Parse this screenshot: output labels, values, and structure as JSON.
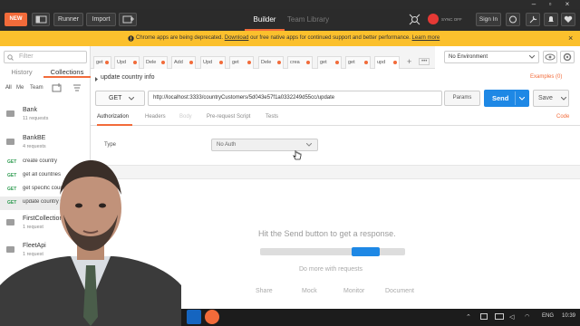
{
  "header": {
    "new_label": "NEW",
    "runner_label": "Runner",
    "import_label": "Import",
    "tab_builder": "Builder",
    "tab_team_library": "Team Library",
    "sync_status": "SYNC OFF",
    "sign_in_label": "Sign In",
    "accent_color": "#f26b3a"
  },
  "warning": {
    "prefix": "Chrome apps are being deprecated.",
    "link_download": "Download",
    "middle": "our free native apps for continued support and better performance.",
    "link_learn": "Learn more"
  },
  "sidebar": {
    "filter_placeholder": "Filter",
    "tab_history": "History",
    "tab_collections": "Collections",
    "sub_all": "All",
    "sub_me": "Me",
    "sub_team": "Team",
    "collections": [
      {
        "name": "Bank",
        "count": "11 requests"
      },
      {
        "name": "BankBE",
        "count": "4 requests"
      }
    ],
    "requests": [
      {
        "method": "GET",
        "name": "create country"
      },
      {
        "method": "GET",
        "name": "get all countries"
      },
      {
        "method": "GET",
        "name": "get specific country"
      },
      {
        "method": "GET",
        "name": "update country info"
      }
    ],
    "collections_more": [
      {
        "name": "FirstCollection",
        "count": "1 request"
      },
      {
        "name": "FleetApi",
        "count": "1 request"
      }
    ]
  },
  "tabs": [
    "get",
    "Upd",
    "Dele",
    "Add",
    "Upd",
    "get",
    "Dele",
    "crea",
    "get",
    "get",
    "upd"
  ],
  "tab_add": "+",
  "tab_more": "•••",
  "environment": {
    "selected": "No Environment"
  },
  "request": {
    "title": "update country info",
    "examples": "Examples (0)",
    "method": "GET",
    "url": "http://localhost:3333/countryCustomers/5d043e57f1a0332249d55cc/update",
    "params_label": "Params",
    "send_label": "Send",
    "save_label": "Save",
    "subtabs": [
      "Authorization",
      "Headers",
      "Body",
      "Pre-request Script",
      "Tests"
    ],
    "code_label": "Code",
    "type_label": "Type",
    "auth_value": "No Auth"
  },
  "response": {
    "empty_message": "Hit the Send button to get a response.",
    "do_more": "Do more with requests",
    "actions": [
      "Share",
      "Mock",
      "Monitor",
      "Document"
    ]
  },
  "taskbar": {
    "language": "ENG",
    "time": "10:39"
  }
}
